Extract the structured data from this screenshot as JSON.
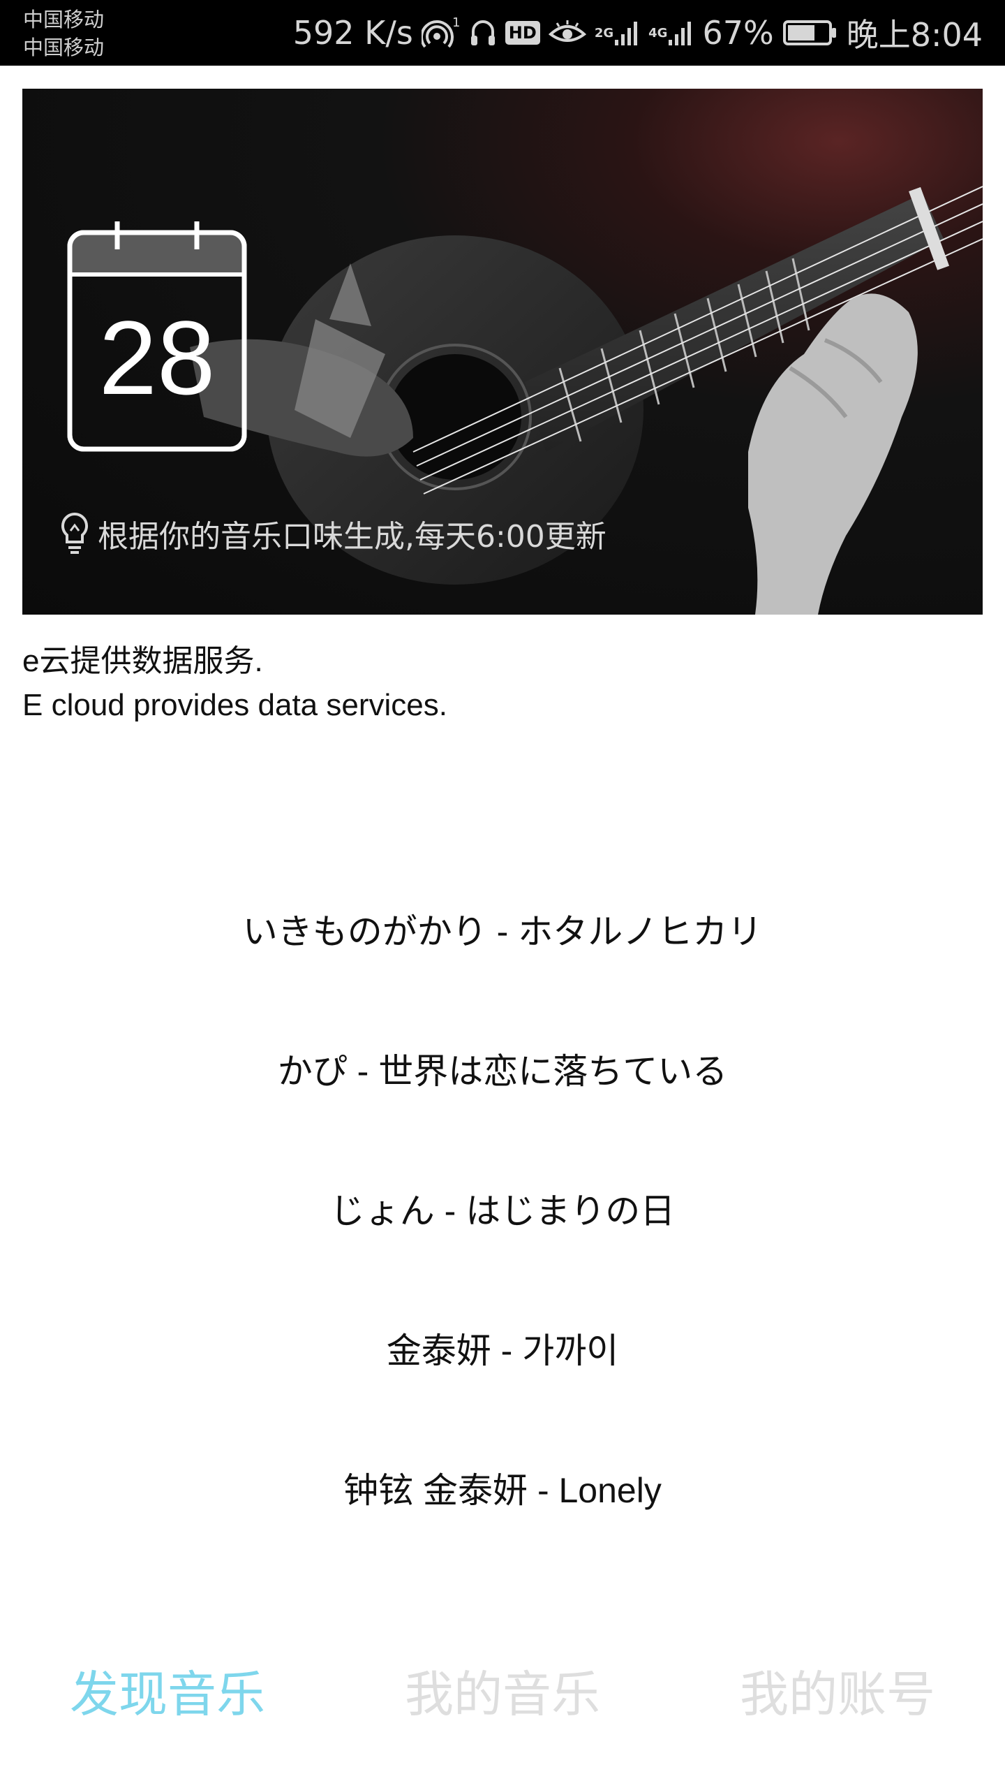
{
  "status_bar": {
    "carrier_1": "中国移动",
    "carrier_2": "中国移动",
    "net_speed": "592 K/s",
    "hd": "HD",
    "sig_2g": "2G",
    "sig_4g": "4G",
    "battery": "67%",
    "time": "晚上8:04",
    "battery_level": 0.67
  },
  "banner": {
    "day": "28",
    "caption": "根据你的音乐口味生成,每天6:00更新"
  },
  "info": {
    "line_1": "e云提供数据服务.",
    "line_2": "E cloud provides data services."
  },
  "songs": [
    "いきものがかり - ホタルノヒカリ",
    "かぴ - 世界は恋に落ちている",
    "じょん - はじまりの日",
    "金泰妍 - 가까이",
    "钟铉 金泰妍 - Lonely"
  ],
  "nav": {
    "discover": "发现音乐",
    "my_music": "我的音乐",
    "my_account": "我的账号"
  },
  "colors": {
    "active_tab": "#7ed6ec",
    "inactive_tab": "#dedede"
  }
}
